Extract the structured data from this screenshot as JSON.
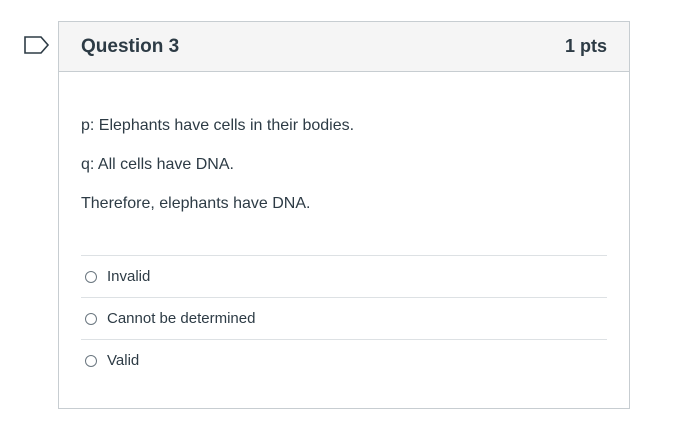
{
  "question": {
    "title": "Question 3",
    "points": "1 pts",
    "text": [
      "p: Elephants have cells in their bodies.",
      "q: All cells have DNA.",
      "Therefore, elephants have DNA."
    ],
    "answers": [
      {
        "label": "Invalid"
      },
      {
        "label": "Cannot be determined"
      },
      {
        "label": "Valid"
      }
    ]
  },
  "colors": {
    "flag": "#2d3b45",
    "header_bg": "#f5f5f5",
    "border": "#c7cdd1"
  },
  "icons": {
    "flag": "bookmark-flag-icon",
    "radio": "radio-button-icon"
  }
}
